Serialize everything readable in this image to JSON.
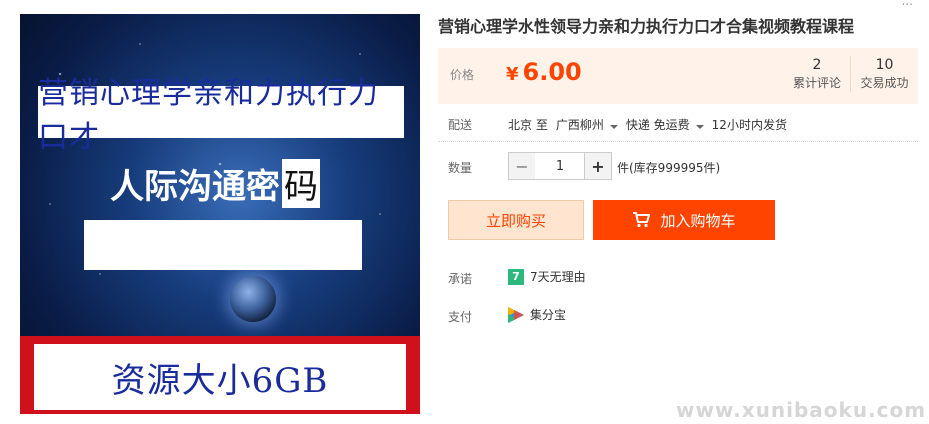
{
  "product_image": {
    "banner_top": "营销心理学亲和力执行力口才",
    "banner_mid": "人际沟通密",
    "banner_mid_boxed": "码",
    "banner_bottom": "资源大小6GB"
  },
  "title": "营销心理学水性领导力亲和力执行力口才合集视频教程课程",
  "price": {
    "label": "价格",
    "currency": "¥",
    "value": "6.00"
  },
  "stats": [
    {
      "num": "2",
      "label": "累计评论"
    },
    {
      "num": "10",
      "label": "交易成功"
    }
  ],
  "delivery": {
    "label": "配送",
    "from": "北京 至",
    "to": "广西柳州",
    "method": "快递 免运费",
    "ship_time": "12小时内发货"
  },
  "quantity": {
    "label": "数量",
    "minus": "−",
    "value": "1",
    "plus": "+",
    "stock": "件(库存999995件)"
  },
  "buttons": {
    "buy_now": "立即购买",
    "add_to_cart": "加入购物车"
  },
  "promise": {
    "label": "承诺",
    "icon_text": "7",
    "text": "7天无理由"
  },
  "payment": {
    "label": "支付",
    "text": "集分宝"
  },
  "watermark": "www.xunibaoku.com",
  "corner_mark": "...",
  "colors": {
    "accent": "#ff4400",
    "price_bg": "#fff2e8",
    "buy_bg": "#ffe4d0",
    "promise_green": "#2db87d"
  },
  "icons": {
    "cart": "cart-icon",
    "seven_day": "seven-day-icon",
    "jifenbao": "jifenbao-icon",
    "caret": "chevron-down-icon"
  }
}
